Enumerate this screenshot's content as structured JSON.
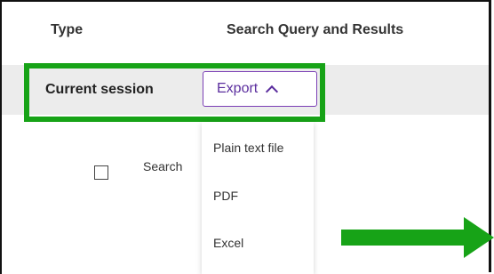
{
  "table": {
    "headers": {
      "type": "Type",
      "search_query_results": "Search Query and Results"
    }
  },
  "session": {
    "label": "Current session",
    "export_button": {
      "label": "Export",
      "icon": "chevron-up-icon"
    }
  },
  "dropdown": {
    "options": [
      "Plain text file",
      "PDF",
      "Excel"
    ]
  },
  "row": {
    "search_text": "Search",
    "checkbox_checked": false
  },
  "colors": {
    "highlight": "#17a317",
    "accent": "#5b2e9e",
    "arrow": "#17a317"
  }
}
